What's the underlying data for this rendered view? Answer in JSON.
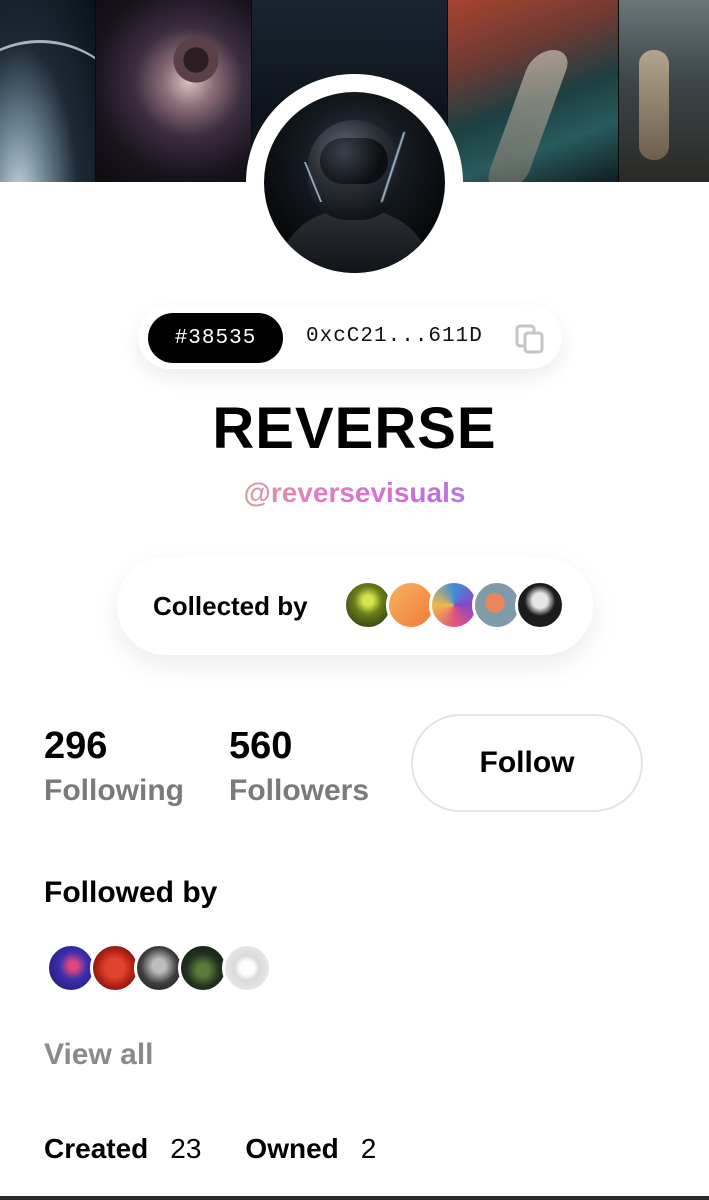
{
  "banner": {
    "images": [
      "earth-horizon",
      "eye-planets",
      "dark-forest",
      "winding-road",
      "astronaut-standing"
    ]
  },
  "profile": {
    "token_id": "#38535",
    "address": "0xcC21...611D",
    "name": "REVERSE",
    "handle": "@reversevisuals",
    "handle_gradient": [
      "#f2c94c",
      "#b6d36b",
      "#e77ac1",
      "#c96cdc",
      "#6aa2f3",
      "#4fb5f5"
    ]
  },
  "collected_by": {
    "label": "Collected by",
    "avatars": [
      "#6b7d1a",
      "#f29a45",
      "#8a46c7",
      "#7f9aa8",
      "#1b1b1b"
    ]
  },
  "stats": {
    "following_count": "296",
    "following_label": "Following",
    "followers_count": "560",
    "followers_label": "Followers",
    "follow_button": "Follow"
  },
  "followed_by": {
    "title": "Followed by",
    "avatars": [
      "#3c2fae",
      "#b62218",
      "#3e3e3e",
      "#213320",
      "#dadada"
    ],
    "view_all": "View all"
  },
  "tabs": [
    {
      "label": "Created",
      "count": "23"
    },
    {
      "label": "Owned",
      "count": "2"
    }
  ]
}
